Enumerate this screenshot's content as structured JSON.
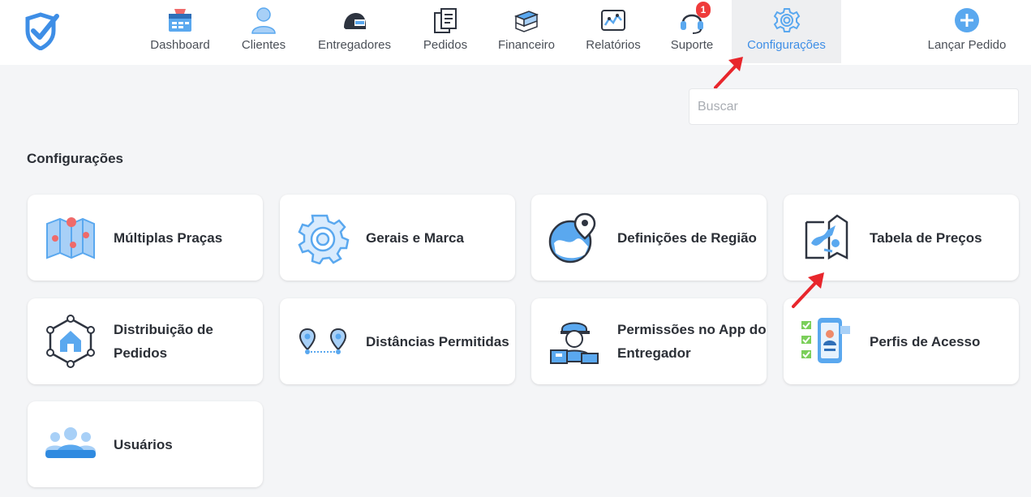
{
  "nav": {
    "items": [
      {
        "label": "Dashboard",
        "icon": "dashboard-icon"
      },
      {
        "label": "Clientes",
        "icon": "user-icon"
      },
      {
        "label": "Entregadores",
        "icon": "helmet-icon"
      },
      {
        "label": "Pedidos",
        "icon": "orders-icon"
      },
      {
        "label": "Financeiro",
        "icon": "money-icon"
      },
      {
        "label": "Relatórios",
        "icon": "chart-icon"
      },
      {
        "label": "Suporte",
        "icon": "headset-icon",
        "badge": "1"
      },
      {
        "label": "Configurações",
        "icon": "gear-icon",
        "active": true
      }
    ],
    "launch_label": "Lançar Pedido"
  },
  "search": {
    "placeholder": "Buscar",
    "value": ""
  },
  "section_title": "Configurações",
  "cards": [
    {
      "label": "Múltiplas Praças",
      "icon": "map-pins-icon"
    },
    {
      "label": "Gerais e Marca",
      "icon": "gear-icon"
    },
    {
      "label": "Definições de Região",
      "icon": "region-pin-icon"
    },
    {
      "label": "Tabela de Preços",
      "icon": "price-table-icon"
    },
    {
      "label": "Distribuição de Pedidos",
      "icon": "distribution-icon"
    },
    {
      "label": "Distâncias Permitidas",
      "icon": "distance-pins-icon"
    },
    {
      "label": "Permissões no App do Entregador",
      "icon": "courier-icon"
    },
    {
      "label": "Perfis de Acesso",
      "icon": "profile-checklist-icon"
    },
    {
      "label": "Usuários",
      "icon": "users-group-icon"
    }
  ],
  "colors": {
    "accent": "#3e8ee6",
    "icon_blue": "#5aa8ef",
    "badge": "#ef3b3b",
    "annotation_arrow": "#e8262c"
  }
}
